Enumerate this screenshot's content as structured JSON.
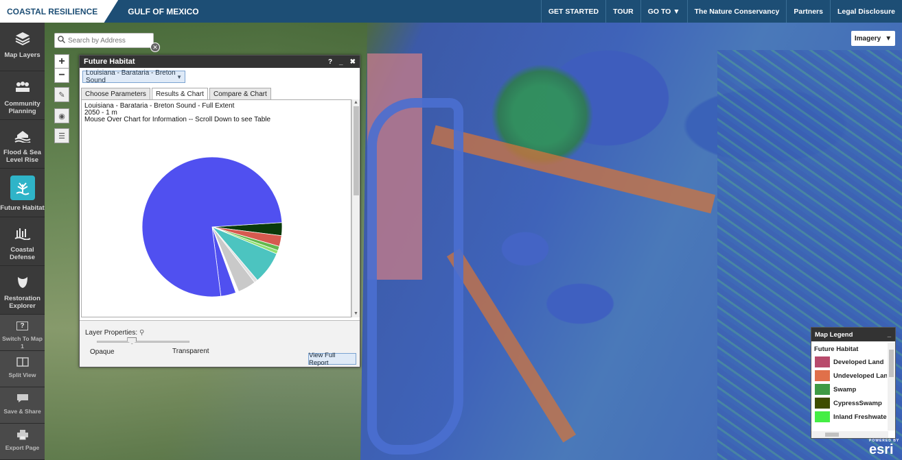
{
  "topbar": {
    "brand": "COASTAL RESILIENCE",
    "region": "GULF OF MEXICO",
    "nav": [
      "GET STARTED",
      "TOUR",
      "GO TO ▼",
      "The Nature Conservancy",
      "Partners",
      "Legal Disclosure"
    ]
  },
  "sidebar": {
    "items": [
      {
        "label": "Map Layers"
      },
      {
        "label": "Community Planning"
      },
      {
        "label": "Flood & Sea Level Rise"
      },
      {
        "label": "Future Habitat"
      },
      {
        "label": "Coastal Defense"
      },
      {
        "label": "Restoration Explorer"
      }
    ],
    "tools": [
      {
        "label": "Switch To Map 1",
        "glyph": "?"
      },
      {
        "label": "Split View"
      },
      {
        "label": "Save & Share"
      },
      {
        "label": "Export Page"
      }
    ]
  },
  "map": {
    "search_placeholder": "Search by Address",
    "basemap": "Imagery"
  },
  "panel": {
    "title": "Future Habitat",
    "header_help": "?",
    "header_min": "_",
    "header_close": "✖",
    "selected_region": "Louisiana - Barataria - Breton Sound",
    "tabs": [
      "Choose Parameters",
      "Results & Chart",
      "Compare & Chart"
    ],
    "active_tab": 1,
    "info_lines": [
      "Louisiana - Barataria - Breton Sound - Full Extent",
      "2050 - 1 m",
      "Mouse Over Chart for Information -- Scroll Down to see Table"
    ],
    "layer_properties": "Layer Properties:",
    "opacity_min": "Opaque",
    "opacity_max": "Transparent",
    "opacity_value": 0.38,
    "report_button": "View Full Report"
  },
  "chart_data": {
    "type": "pie",
    "slices": [
      {
        "value": 76.0,
        "color": "#5050f0"
      },
      {
        "value": 3.0,
        "color": "#0a3a0a"
      },
      {
        "value": 2.5,
        "color": "#d65a4f"
      },
      {
        "value": 1.0,
        "color": "#63b84e"
      },
      {
        "value": 0.8,
        "color": "#90e070"
      },
      {
        "value": 7.5,
        "color": "#4cc4c0"
      },
      {
        "value": 0.8,
        "color": "#e0e0e0"
      },
      {
        "value": 4.2,
        "color": "#c9c9c9"
      },
      {
        "value": 0.7,
        "color": "#ffffff"
      },
      {
        "value": 3.5,
        "color": "#5050f0"
      }
    ]
  },
  "legend": {
    "title": "Map Legend",
    "subtitle": "Future Habitat",
    "items": [
      {
        "label": "Developed Land",
        "color": "#b84a6b"
      },
      {
        "label": "Undeveloped Land",
        "color": "#e0704a"
      },
      {
        "label": "Swamp",
        "color": "#3e9a44"
      },
      {
        "label": "CypressSwamp",
        "color": "#3e4d00"
      },
      {
        "label": "Inland Freshwater Marsh",
        "color": "#44ee44"
      }
    ]
  },
  "esri": {
    "powered": "POWERED BY",
    "logo": "esri"
  }
}
